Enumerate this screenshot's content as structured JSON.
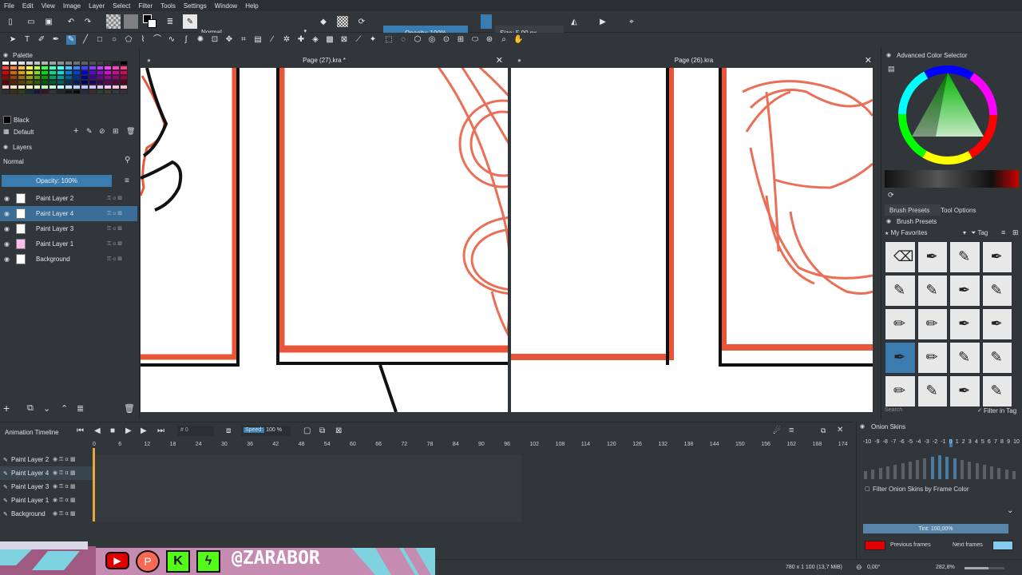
{
  "menu": [
    "File",
    "Edit",
    "View",
    "Image",
    "Layer",
    "Select",
    "Filter",
    "Tools",
    "Settings",
    "Window",
    "Help"
  ],
  "toolbar": {
    "blend_mode": "Normal",
    "opacity_label": "Opacity: 100%",
    "size_label": "Size: 5,00 px"
  },
  "palette": {
    "title": "Palette",
    "selected_color": "Black",
    "set_name": "Default"
  },
  "layers_panel": {
    "title": "Layers",
    "blend_mode": "Normal",
    "opacity_label": "Opacity:  100%",
    "items": [
      {
        "name": "Paint Layer 2",
        "selected": false
      },
      {
        "name": "Paint Layer 4",
        "selected": true
      },
      {
        "name": "Paint Layer 3",
        "selected": false
      },
      {
        "name": "Paint Layer 1",
        "selected": false
      },
      {
        "name": "Background",
        "selected": false
      }
    ]
  },
  "documents": [
    {
      "title": "Page (27).kra *"
    },
    {
      "title": "Page (26).kra"
    }
  ],
  "color_selector": {
    "title": "Advanced Color Selector"
  },
  "brush_tabs": [
    "Brush Presets",
    "Tool Options"
  ],
  "brush_presets": {
    "title": "Brush Presets",
    "tag": "My Favorites",
    "tag_button": "Tag",
    "search_placeholder": "Search",
    "filter_label": "Filter in Tag"
  },
  "timeline": {
    "title": "Animation Timeline",
    "current_frame": "0",
    "speed_label": "Speed:",
    "speed_value": "100 %",
    "frame_numbers": [
      "0",
      "6",
      "12",
      "18",
      "24",
      "30",
      "36",
      "42",
      "48",
      "54",
      "60",
      "66",
      "72",
      "78",
      "84",
      "90",
      "96",
      "102",
      "108",
      "114",
      "120",
      "126",
      "132",
      "138",
      "144",
      "150",
      "156",
      "162",
      "168",
      "174"
    ],
    "layers": [
      "Paint Layer 2",
      "Paint Layer 4",
      "Paint Layer 3",
      "Paint Layer 1",
      "Background"
    ]
  },
  "onion_skins": {
    "title": "Onion Skins",
    "numbers": [
      "-10",
      "-9",
      "-8",
      "-7",
      "-6",
      "-5",
      "-4",
      "-3",
      "-2",
      "-1",
      "0",
      "1",
      "2",
      "3",
      "4",
      "5",
      "6",
      "7",
      "8",
      "9",
      "10"
    ],
    "filter_label": "Filter Onion Skins by Frame Color",
    "tint_label": "Tint: 100,00%",
    "previous_label": "Previous frames",
    "next_label": "Next frames",
    "previous_color": "#e00000",
    "next_color": "#87c8ee"
  },
  "status": {
    "dimensions": "780 x 1 100 (13,7 MiB)",
    "rotation": "0,00°",
    "zoom": "282,8%"
  },
  "overlay": {
    "handle": "@ZARABOR"
  },
  "colors": {
    "accent": "#3a7cb0",
    "sketch_red": "#e8563a"
  }
}
